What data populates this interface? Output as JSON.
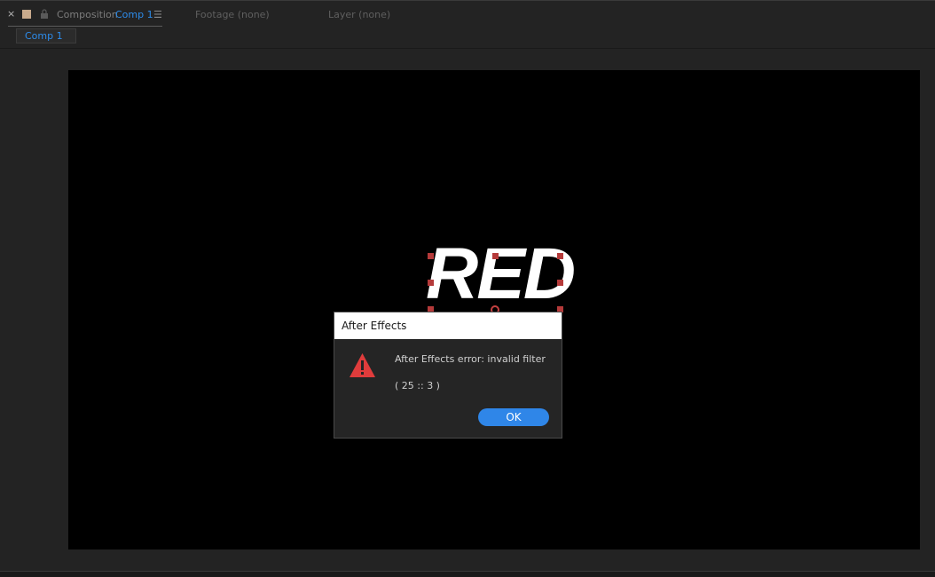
{
  "tabbar": {
    "close_glyph": "×",
    "comp_tab_prefix": "Composition",
    "comp_tab_name": "Comp 1",
    "menu_glyph": "☰",
    "footage_tab": "Footage  (none)",
    "layer_tab": "Layer  (none)"
  },
  "breadcrumb": {
    "label": "Comp 1"
  },
  "viewer": {
    "layer_text": "RED"
  },
  "dialog": {
    "title": "After Effects",
    "message": "After Effects error: invalid filter",
    "code": "( 25 :: 3 )",
    "ok_label": "OK"
  },
  "colors": {
    "accent": "#2d8ceb",
    "handle": "#b53a3a",
    "warning": "#e03c3c",
    "button": "#2f86e8"
  }
}
